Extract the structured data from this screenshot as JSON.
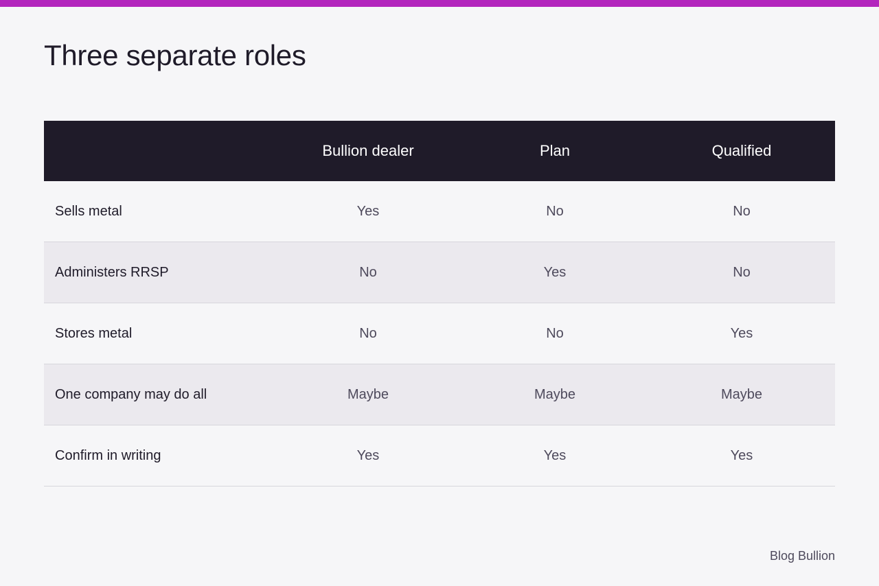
{
  "colors": {
    "accent_bar": "#b325bd",
    "header_background": "#1f1b29",
    "header_text": "#ffffff",
    "alt_row_background": "#ebe9ee",
    "page_background": "#f6f6f8"
  },
  "page": {
    "title": "Three separate roles",
    "footer": "Blog Bullion"
  },
  "table": {
    "headers": [
      "",
      "Bullion dealer",
      "Plan",
      "Qualified"
    ],
    "rows": [
      {
        "label": "Sells metal",
        "values": [
          "Yes",
          "No",
          "No"
        ]
      },
      {
        "label": "Administers RRSP",
        "values": [
          "No",
          "Yes",
          "No"
        ]
      },
      {
        "label": "Stores metal",
        "values": [
          "No",
          "No",
          "Yes"
        ]
      },
      {
        "label": "One company may do all",
        "values": [
          "Maybe",
          "Maybe",
          "Maybe"
        ]
      },
      {
        "label": "Confirm in writing",
        "values": [
          "Yes",
          "Yes",
          "Yes"
        ]
      }
    ]
  }
}
